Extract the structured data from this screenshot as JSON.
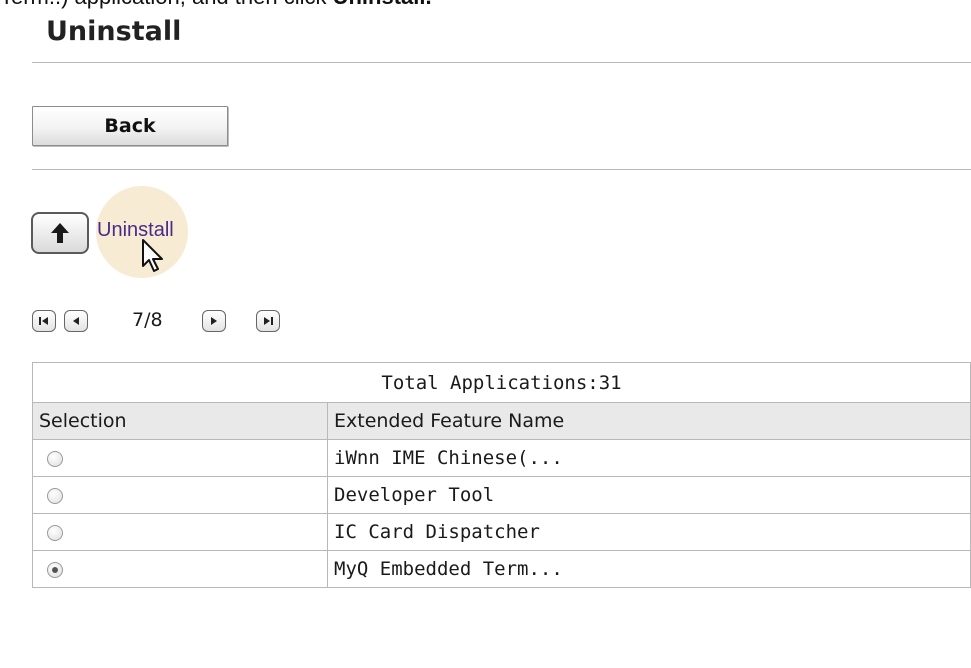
{
  "caption": {
    "text_before": "Term..) application, and then click ",
    "text_bold": "Uninstall.",
    "text_after": ""
  },
  "page": {
    "title": "Uninstall"
  },
  "toolbar": {
    "back_label": "Back"
  },
  "uninstall": {
    "label": "Uninstall"
  },
  "pager": {
    "indicator": "7/8"
  },
  "table": {
    "total_label": "Total Applications:31",
    "headers": [
      "Selection",
      "Extended Feature Name"
    ],
    "rows": [
      {
        "name": "iWnn IME Chinese(...",
        "selected": false
      },
      {
        "name": "Developer Tool",
        "selected": false
      },
      {
        "name": "IC Card Dispatcher",
        "selected": false
      },
      {
        "name": "MyQ Embedded Term...",
        "selected": true
      }
    ]
  },
  "colors": {
    "link": "#4a2a8a",
    "header_bg": "#e9e9e9",
    "border": "#b8b8b8",
    "halo": "#eed2a0"
  },
  "icons": {
    "up": "arrow-up-icon",
    "first": "first-page-icon",
    "prev": "prev-page-icon",
    "next": "next-page-icon",
    "last": "last-page-icon",
    "cursor": "mouse-pointer-icon"
  }
}
